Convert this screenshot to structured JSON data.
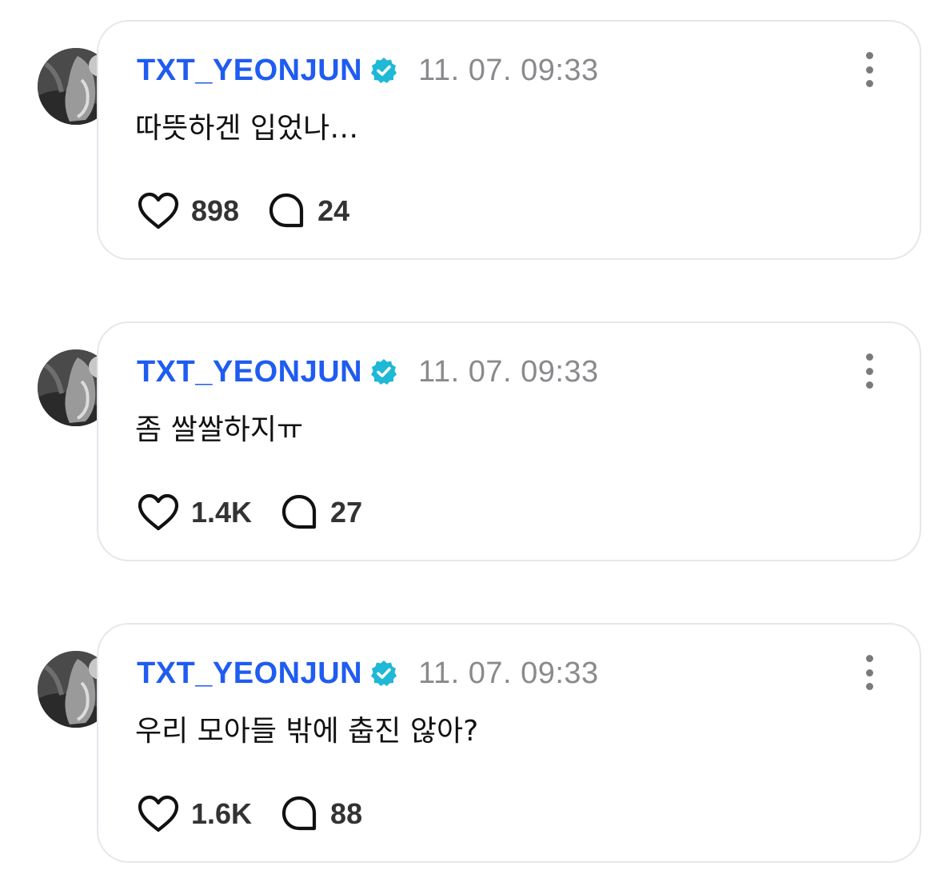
{
  "colors": {
    "username": "#1f5cf0",
    "verified_badge": "#1fb8d6",
    "timestamp": "#8a8a8e",
    "card_border": "#e6e6ec",
    "text": "#111111"
  },
  "icons": {
    "verified": "verified-badge-icon",
    "like": "heart-icon",
    "reply": "speech-bubble-icon",
    "more": "more-vertical-icon"
  },
  "posts": [
    {
      "username": "TXT_YEONJUN",
      "timestamp": "11. 07. 09:33",
      "text": "따뜻하겐 입었나…",
      "likes": "898",
      "replies": "24"
    },
    {
      "username": "TXT_YEONJUN",
      "timestamp": "11. 07. 09:33",
      "text": "좀 쌀쌀하지ㅠ",
      "likes": "1.4K",
      "replies": "27"
    },
    {
      "username": "TXT_YEONJUN",
      "timestamp": "11. 07. 09:33",
      "text": "우리 모아들 밖에 춥진 않아?",
      "likes": "1.6K",
      "replies": "88"
    }
  ]
}
